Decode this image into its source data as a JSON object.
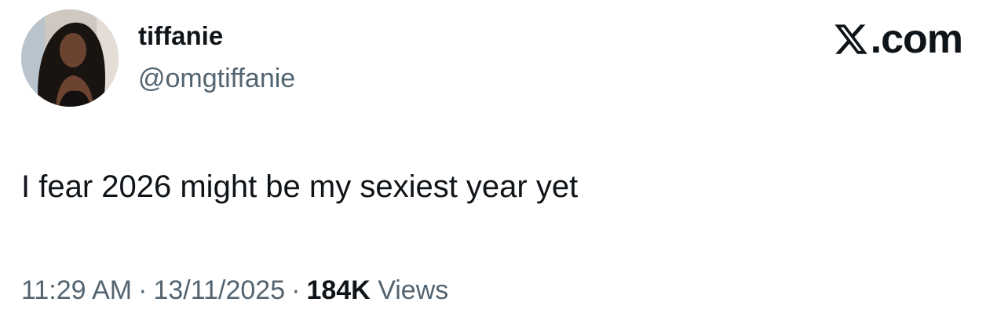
{
  "user": {
    "display_name": "tiffanie",
    "handle": "@omgtiffanie"
  },
  "brand": {
    "logo_icon": "x-logo-icon",
    "suffix": ".com"
  },
  "tweet": {
    "text": "I fear 2026 might be my sexiest year yet",
    "time": "11:29 AM",
    "separator": "·",
    "date": "13/11/2025",
    "views_count": "184K",
    "views_label": "Views"
  },
  "colors": {
    "text_primary": "#0f1419",
    "text_secondary": "#536471",
    "background": "#ffffff"
  }
}
